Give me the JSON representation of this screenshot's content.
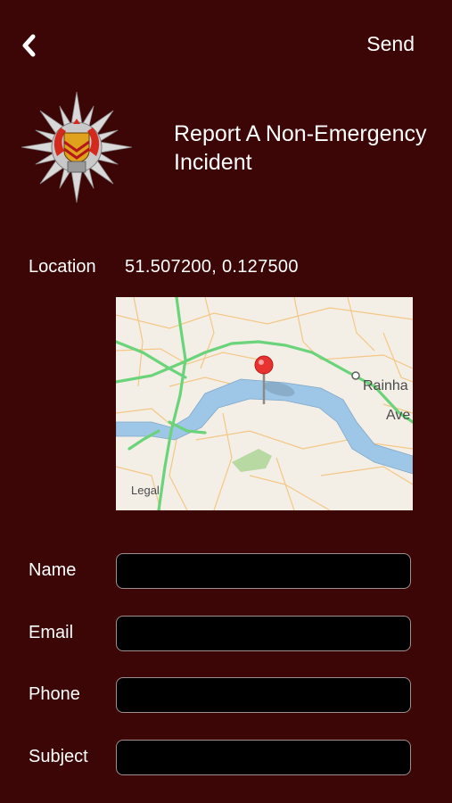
{
  "nav": {
    "back_icon": "chevron-left-icon",
    "send_label": "Send"
  },
  "header": {
    "logo": "fire-brigade-crest",
    "title": "Report A Non-Emergency Incident"
  },
  "location": {
    "label": "Location",
    "coordinates": "51.507200, 0.127500"
  },
  "map": {
    "place_label_1": "Rainha",
    "place_label_2": "Ave",
    "legal_label": "Legal",
    "pin_icon": "map-pin-icon"
  },
  "form": {
    "name_label": "Name",
    "name_value": "",
    "email_label": "Email",
    "email_value": "",
    "phone_label": "Phone",
    "phone_value": "",
    "subject_label": "Subject",
    "subject_value": ""
  },
  "colors": {
    "background": "#3d0606",
    "field_background": "#000000",
    "field_border": "#9c8f8f",
    "text": "#ffffff",
    "pin": "#e8322f",
    "river": "#9ec6e6",
    "road_major": "#6bd37a",
    "road_minor": "#f3c786"
  }
}
